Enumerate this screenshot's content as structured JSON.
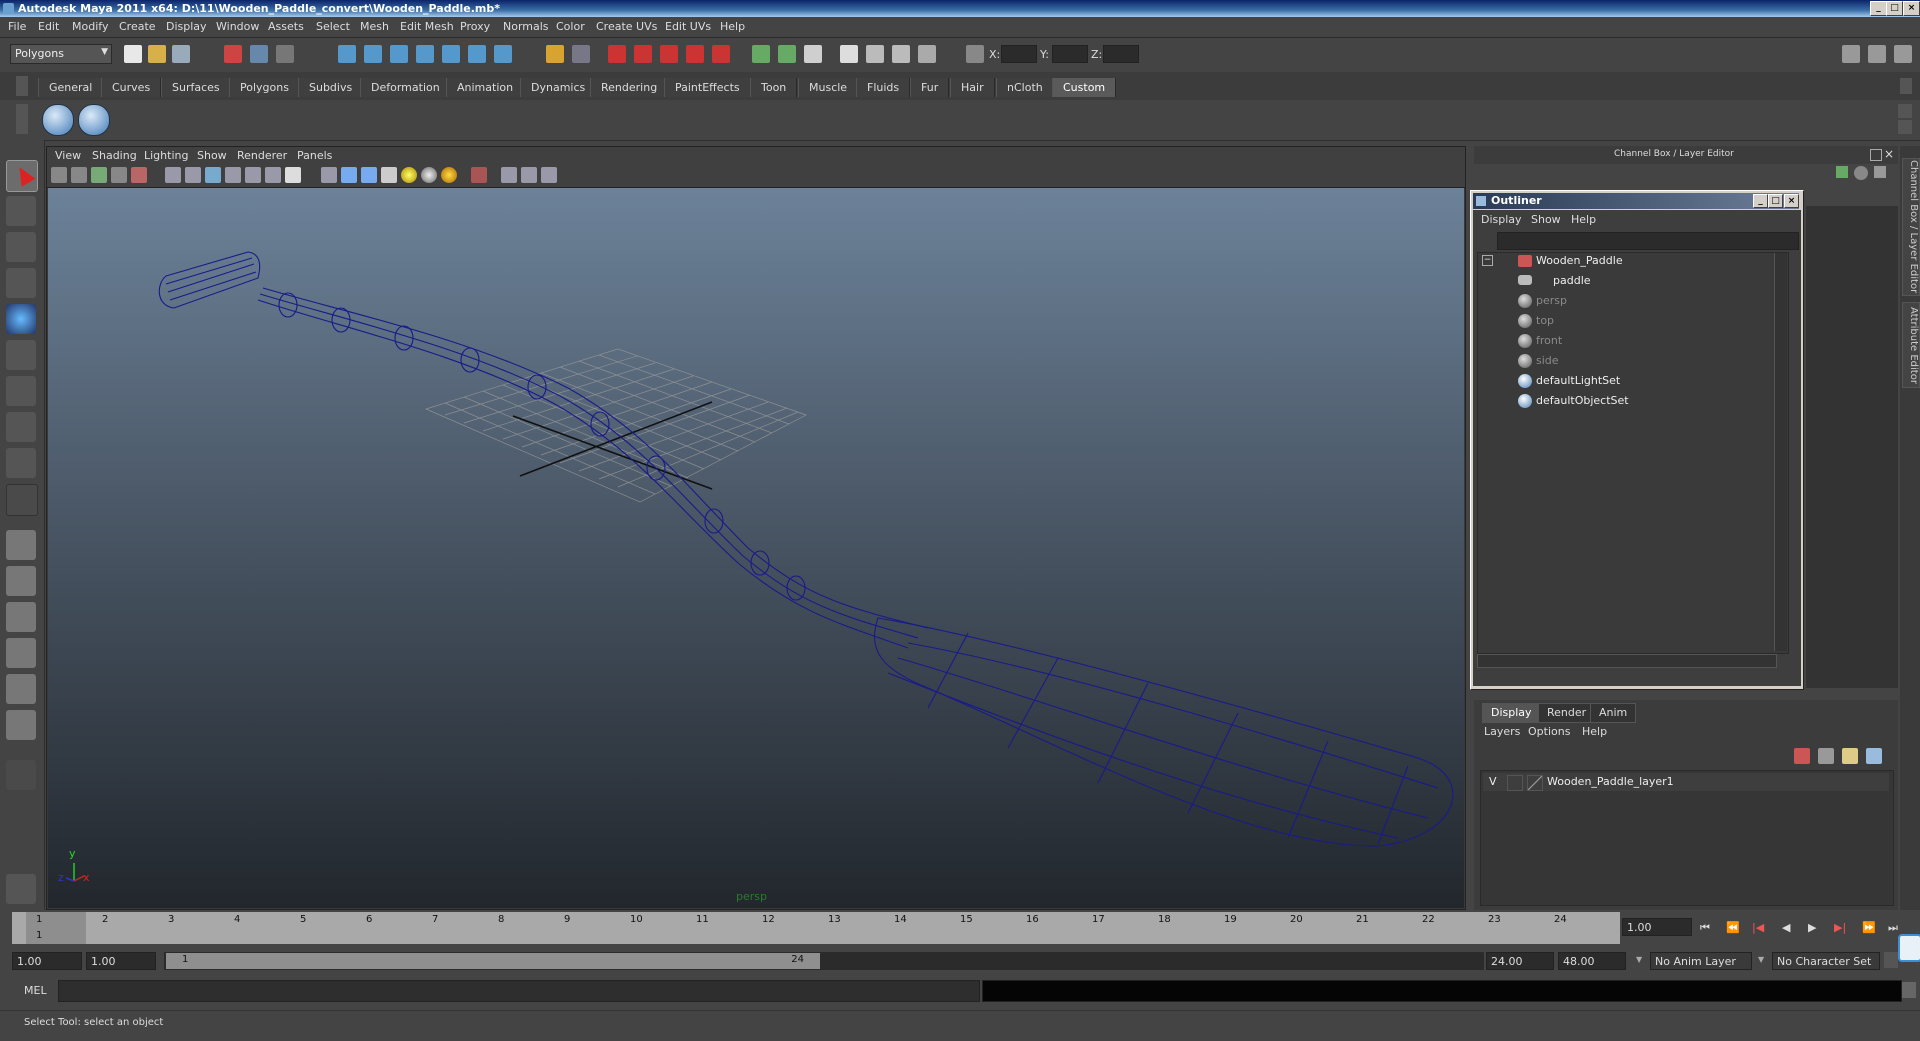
{
  "window": {
    "title": "Autodesk Maya 2011 x64: D:\\11\\Wooden_Paddle_convert\\Wooden_Paddle.mb*",
    "btn_min": "_",
    "btn_max": "□",
    "btn_close": "×"
  },
  "menus": [
    "File",
    "Edit",
    "Modify",
    "Create",
    "Display",
    "Window",
    "Assets",
    "Select",
    "Mesh",
    "Edit Mesh",
    "Proxy",
    "Normals",
    "Color",
    "Create UVs",
    "Edit UVs",
    "Help"
  ],
  "status_line": {
    "menuset": "Polygons",
    "x_label": "X:",
    "y_label": "Y:",
    "z_label": "Z:"
  },
  "shelf_tabs": [
    "General",
    "Curves",
    "Surfaces",
    "Polygons",
    "Subdivs",
    "Deformation",
    "Animation",
    "Dynamics",
    "Rendering",
    "PaintEffects",
    "Toon",
    "Muscle",
    "Fluids",
    "Fur",
    "Hair",
    "nCloth",
    "Custom"
  ],
  "shelf_active": "Custom",
  "viewport": {
    "menus": [
      "View",
      "Shading",
      "Lighting",
      "Show",
      "Renderer",
      "Panels"
    ],
    "camera_label": "persp",
    "axis_x": "x",
    "axis_y": "y",
    "axis_z": "z"
  },
  "channel_box": {
    "title": "Channel Box / Layer Editor"
  },
  "outliner": {
    "title": "Outliner",
    "menus": [
      "Display",
      "Show",
      "Help"
    ],
    "expand": "−",
    "items": [
      {
        "label": "Wooden_Paddle",
        "dim": false
      },
      {
        "label": "paddle",
        "dim": false
      },
      {
        "label": "persp",
        "dim": true
      },
      {
        "label": "top",
        "dim": true
      },
      {
        "label": "front",
        "dim": true
      },
      {
        "label": "side",
        "dim": true
      },
      {
        "label": "defaultLightSet",
        "dim": false
      },
      {
        "label": "defaultObjectSet",
        "dim": false
      }
    ]
  },
  "layer_editor": {
    "tabs": [
      "Display",
      "Render",
      "Anim"
    ],
    "menus": [
      "Layers",
      "Options",
      "Help"
    ],
    "layer_visible": "V",
    "layer_name": "Wooden_Paddle_layer1"
  },
  "side_tabs": [
    "Channel Box / Layer Editor",
    "Attribute Editor"
  ],
  "time_slider": {
    "ticks": [
      "1",
      "2",
      "3",
      "4",
      "5",
      "6",
      "7",
      "8",
      "9",
      "10",
      "11",
      "12",
      "13",
      "14",
      "15",
      "16",
      "17",
      "18",
      "19",
      "20",
      "21",
      "22",
      "23",
      "24"
    ],
    "current_marker": "1",
    "current_frame": "1.00"
  },
  "range_slider": {
    "start_time": "1.00",
    "playback_start": "1.00",
    "range_low": "1",
    "range_high": "24",
    "playback_end": "24.00",
    "end_time": "48.00",
    "anim_layer": "No Anim Layer",
    "character_set": "No Character Set"
  },
  "command_line": {
    "label": "MEL"
  },
  "help_line": {
    "text": "Select Tool: select an object"
  },
  "colors": {
    "wireframe": "#1a1a8a",
    "grid": "#9a9a9a",
    "viewport_top": "#6c8299",
    "viewport_bottom": "#22272d"
  }
}
